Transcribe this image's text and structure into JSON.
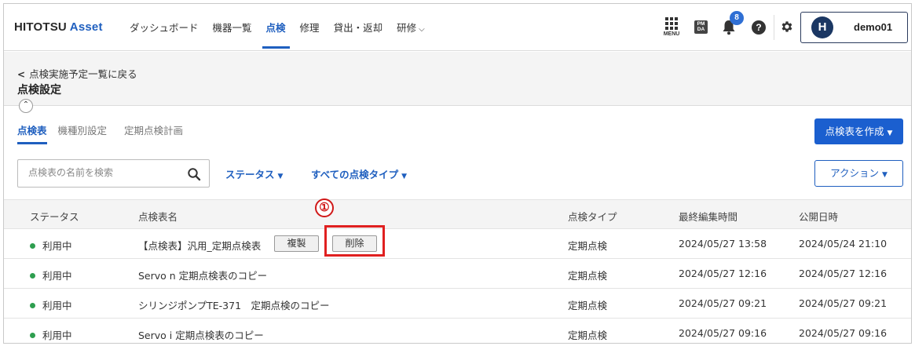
{
  "header": {
    "logo_main": "HITOTSU",
    "logo_accent": "Asset",
    "nav": [
      {
        "label": "ダッシュボード"
      },
      {
        "label": "機器一覧"
      },
      {
        "label": "点検"
      },
      {
        "label": "修理"
      },
      {
        "label": "貸出・返却"
      },
      {
        "label": "研修"
      }
    ],
    "menu_label": "MENU",
    "pmda_top": "PM",
    "pmda_bottom": "DA",
    "notification_count": "8",
    "help_label": "?",
    "avatar_initial": "H",
    "username": "demo01"
  },
  "page": {
    "back_label": "点検実施予定一覧に戻る",
    "title": "点検設定",
    "tabs": [
      {
        "label": "点検表"
      },
      {
        "label": "機種別設定"
      },
      {
        "label": "定期点検計画"
      }
    ],
    "create_button": "点検表を作成"
  },
  "toolbar": {
    "search_placeholder": "点検表の名前を検索",
    "search_value": "",
    "status_filter": "ステータス",
    "type_filter": "すべての点検タイプ",
    "action_button": "アクション"
  },
  "table": {
    "headers": [
      "ステータス",
      "点検表名",
      "点検タイプ",
      "最終編集時間",
      "公開日時"
    ],
    "rows": [
      {
        "status": "利用中",
        "name": "【点検表】汎用_定期点検表",
        "type": "定期点検",
        "edited": "2024/05/27 13:58",
        "published": "2024/05/24 21:10",
        "copy_label": "複製",
        "delete_label": "削除"
      },
      {
        "status": "利用中",
        "name": "Servo n 定期点検表のコピー",
        "type": "定期点検",
        "edited": "2024/05/27 12:16",
        "published": "2024/05/27 12:16"
      },
      {
        "status": "利用中",
        "name": "シリンジポンプTE-371　定期点検のコピー",
        "type": "定期点検",
        "edited": "2024/05/27 09:21",
        "published": "2024/05/27 09:21"
      },
      {
        "status": "利用中",
        "name": "Servo i 定期点検表のコピー",
        "type": "定期点検",
        "edited": "2024/05/27 09:16",
        "published": "2024/05/27 09:16"
      }
    ]
  },
  "annotation": {
    "number": "①"
  },
  "colors": {
    "primary": "#1f5fbf",
    "status_active": "#2e9e4f",
    "annotation": "#e02020",
    "avatar_bg": "#1b3763"
  },
  "icons": [
    "menu-grid-icon",
    "pmda-icon",
    "bell-icon",
    "help-icon",
    "gear-icon",
    "search-icon",
    "chevron-left-icon",
    "chevron-up-icon",
    "caret-down-icon"
  ]
}
